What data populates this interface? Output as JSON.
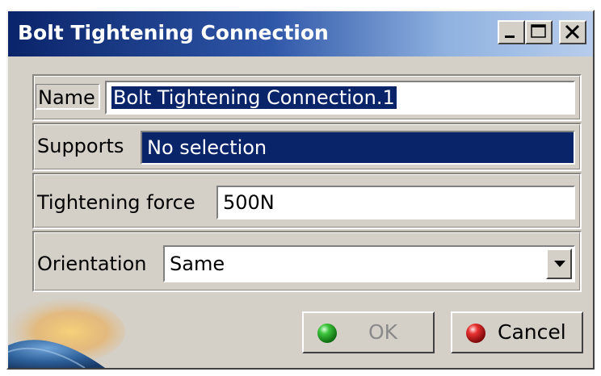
{
  "window": {
    "title": "Bolt Tightening Connection"
  },
  "title_buttons": {
    "minimize_icon": "minimize-icon",
    "maximize_icon": "maximize-icon",
    "close_icon": "close-icon"
  },
  "form": {
    "name_label": "Name",
    "name_value": "Bolt Tightening Connection.1",
    "supports_label": "Supports",
    "supports_value": "No selection",
    "force_label": "Tightening force",
    "force_value": "500N",
    "orientation_label": "Orientation",
    "orientation_value": "Same"
  },
  "buttons": {
    "ok_label": "OK",
    "cancel_label": "Cancel",
    "ok_enabled": false
  },
  "colors": {
    "title_bar": "#0a246a",
    "selection": "#0a246a",
    "dialog_bg": "#d4d0c8",
    "ok_bulb": "#2ca02c",
    "cancel_bulb": "#e02020"
  }
}
